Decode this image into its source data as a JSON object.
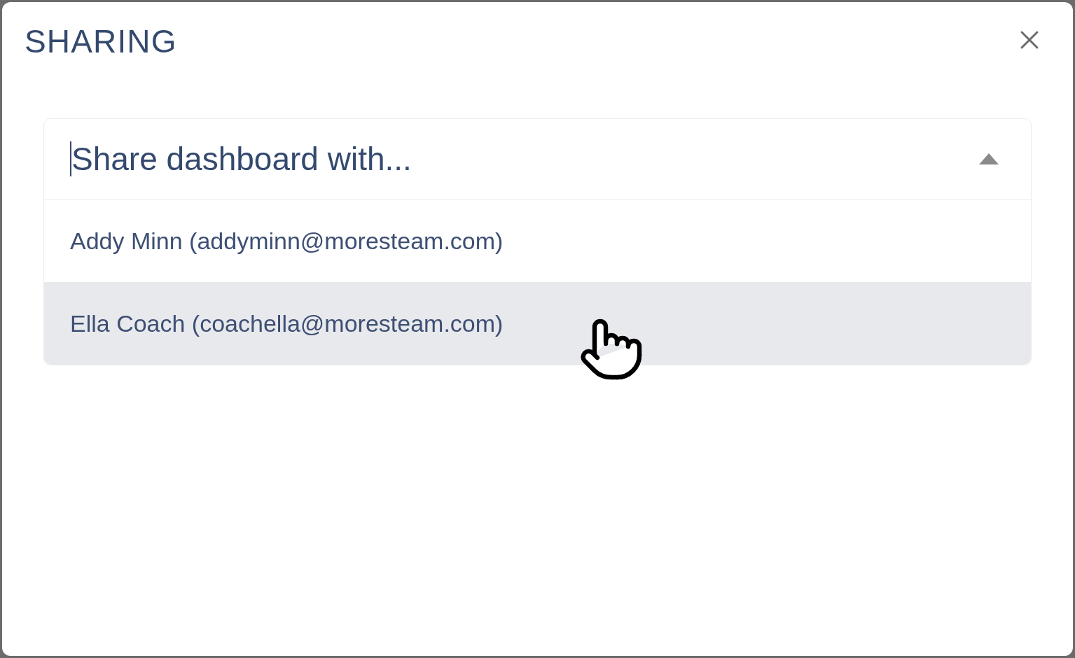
{
  "dialog": {
    "title": "SHARING"
  },
  "share_field": {
    "placeholder": "Share dashboard with...",
    "expanded": true
  },
  "options": [
    {
      "label": "Addy Minn (addyminn@moresteam.com)",
      "selected": false
    },
    {
      "label": "Ella Coach (coachella@moresteam.com)",
      "selected": true
    }
  ]
}
